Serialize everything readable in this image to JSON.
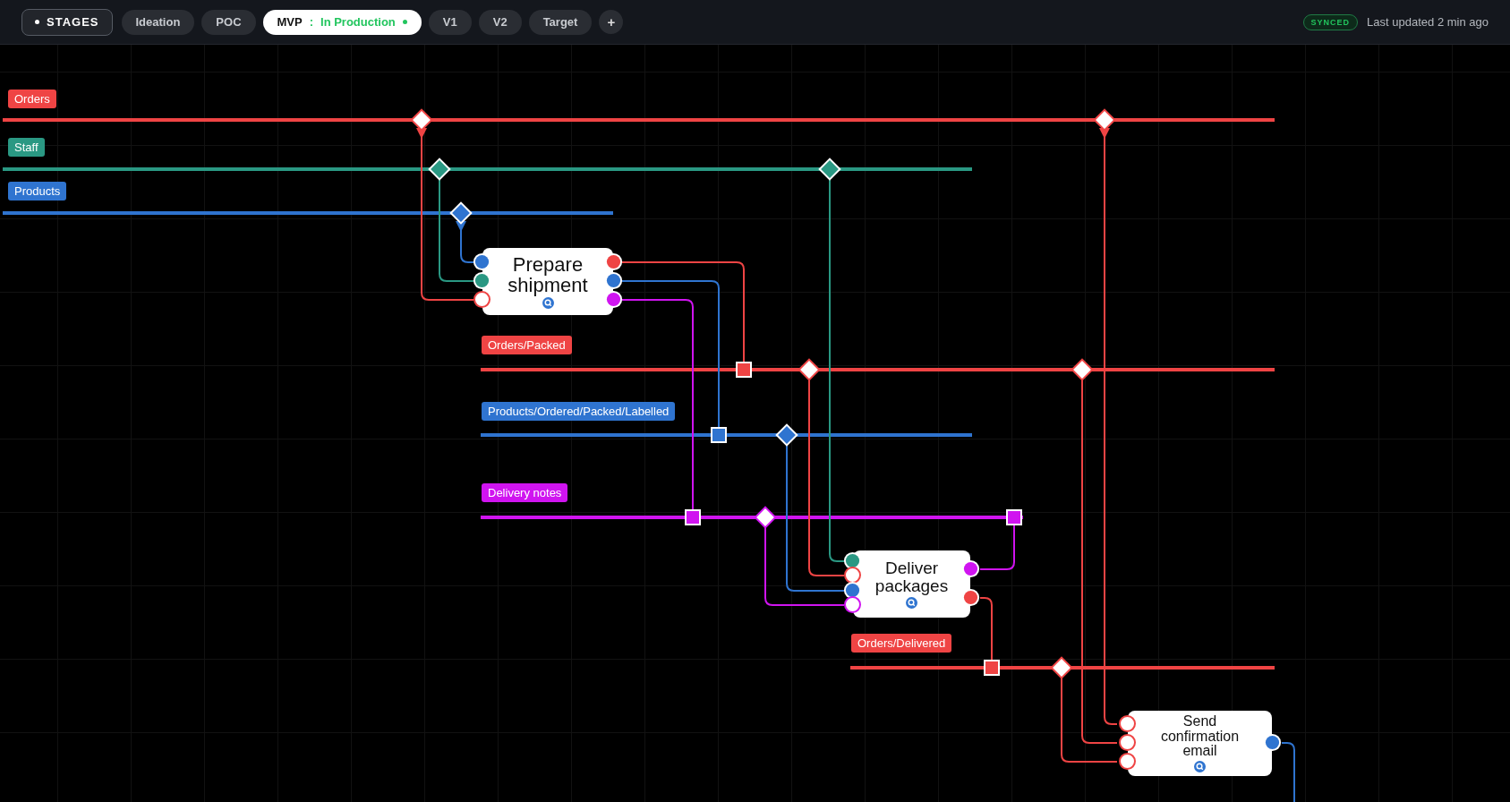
{
  "stages_button": {
    "label": "STAGES"
  },
  "tabs": [
    {
      "label": "Ideation",
      "selected": false
    },
    {
      "label": "POC",
      "selected": false
    },
    {
      "label": "MVP",
      "separator": ":",
      "status": "In Production",
      "selected": true
    },
    {
      "label": "V1",
      "selected": false
    },
    {
      "label": "V2",
      "selected": false
    },
    {
      "label": "Target",
      "selected": false
    }
  ],
  "add_tab": "+",
  "sync": {
    "badge": "SYNCED",
    "updated": "Last updated 2 min ago"
  },
  "lanes": [
    {
      "name": "Orders",
      "color": "#ef4444"
    },
    {
      "name": "Staff",
      "color": "#2a9883"
    },
    {
      "name": "Products",
      "color": "#2f74d0"
    },
    {
      "name": "Orders/Packed",
      "color": "#ef4444"
    },
    {
      "name": "Products/Ordered/Packed/Labelled",
      "color": "#2f74d0"
    },
    {
      "name": "Delivery notes",
      "color": "#d014f0"
    },
    {
      "name": "Orders/Delivered",
      "color": "#ef4444"
    }
  ],
  "nodes": [
    {
      "label": "Prepare shipment",
      "inputs": [
        {
          "color": "#2f74d0",
          "filled": true
        },
        {
          "color": "#2a9883",
          "filled": true
        },
        {
          "color": "#ef4444",
          "filled": false
        }
      ],
      "outputs": [
        {
          "color": "#ef4444"
        },
        {
          "color": "#2f74d0"
        },
        {
          "color": "#d014f0"
        }
      ]
    },
    {
      "label": "Deliver packages",
      "inputs": [
        {
          "color": "#2a9883",
          "filled": true
        },
        {
          "color": "#ef4444",
          "filled": false
        },
        {
          "color": "#2f74d0",
          "filled": true
        },
        {
          "color": "#d014f0",
          "filled": false
        }
      ],
      "outputs": [
        {
          "color": "#d014f0"
        },
        {
          "color": "#ef4444"
        }
      ]
    },
    {
      "label": "Send confirmation email",
      "inputs": [
        {
          "color": "#ef4444",
          "filled": false
        },
        {
          "color": "#ef4444",
          "filled": false
        },
        {
          "color": "#ef4444",
          "filled": false
        }
      ],
      "outputs": [
        {
          "color": "#2f74d0"
        }
      ]
    }
  ]
}
